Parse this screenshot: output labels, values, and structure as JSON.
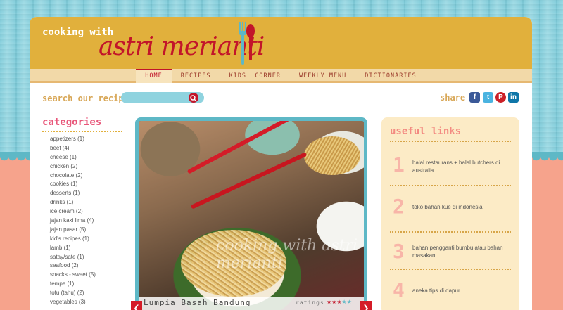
{
  "header": {
    "logo_small": "cooking with",
    "logo_main": "astri merianti"
  },
  "nav": [
    {
      "label": "HOME",
      "active": true
    },
    {
      "label": "RECIPES",
      "active": false
    },
    {
      "label": "KIDS' CORNER",
      "active": false
    },
    {
      "label": "WEEKLY MENU",
      "active": false
    },
    {
      "label": "DICTIONARIES",
      "active": false
    }
  ],
  "search": {
    "label": "search our recipes",
    "placeholder": ""
  },
  "share": {
    "label": "share",
    "icons": [
      "facebook-icon",
      "twitter-icon",
      "pinterest-icon",
      "linkedin-icon"
    ]
  },
  "categories": {
    "title": "categories",
    "items": [
      "appetizers (1)",
      "beef (4)",
      "cheese (1)",
      "chicken (2)",
      "chocolate (2)",
      "cookies (1)",
      "desserts (1)",
      "drinks (1)",
      "ice cream (2)",
      "jajan kaki lima (4)",
      "jajan pasar (5)",
      "kid's recipes (1)",
      "lamb (1)",
      "satay/sate (1)",
      "seafood (2)",
      "snacks - sweet (5)",
      "tempe (1)",
      "tofu (tahu) (2)",
      "vegetables (3)"
    ]
  },
  "feature": {
    "caption": "Lumpia Basah Bandung",
    "ratings_label": "ratings",
    "rating": 3,
    "rating_max": 5,
    "watermark": "cooking with astri merianti"
  },
  "useful_links": {
    "title": "useful links",
    "items": [
      {
        "num": "1",
        "text": "halal restaurans + halal butchers di australia"
      },
      {
        "num": "2",
        "text": "toko bahan kue di indonesia"
      },
      {
        "num": "3",
        "text": "bahan pengganti bumbu atau bahan masakan"
      },
      {
        "num": "4",
        "text": "aneka tips di dapur"
      }
    ]
  },
  "colors": {
    "accent": "#c2152a",
    "header": "#e1b03c",
    "teal": "#5eb8c6",
    "pink": "#e8577a"
  }
}
